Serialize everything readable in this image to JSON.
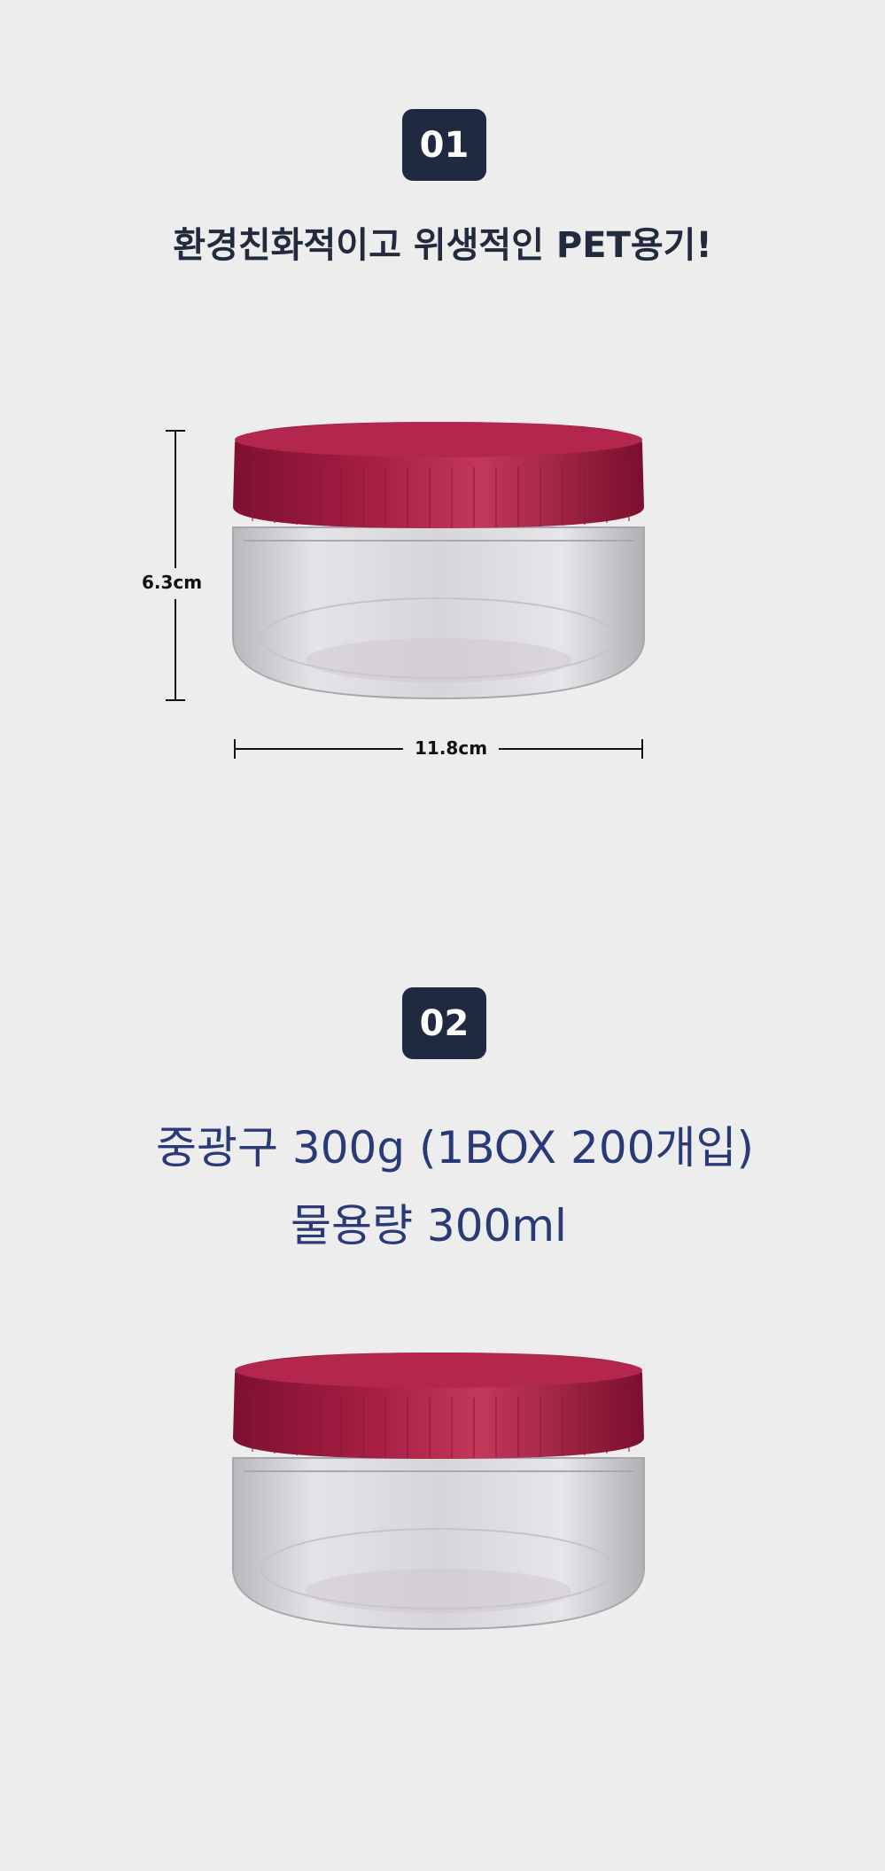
{
  "section1": {
    "badge": "01",
    "headline": "환경친화적이고 위생적인 PET용기!",
    "dimensions": {
      "height_label": "6.3cm",
      "width_label": "11.8cm"
    }
  },
  "section2": {
    "badge": "02",
    "spec_line_1": "중광구 300g (1BOX 200개입)",
    "spec_line_2": "물용량 300ml"
  },
  "colors": {
    "background": "#ededed",
    "badge": "#1f2940",
    "cap": "#9c1a3c",
    "headline_text": "#222a3d",
    "spec_text": "#2a3a78"
  }
}
